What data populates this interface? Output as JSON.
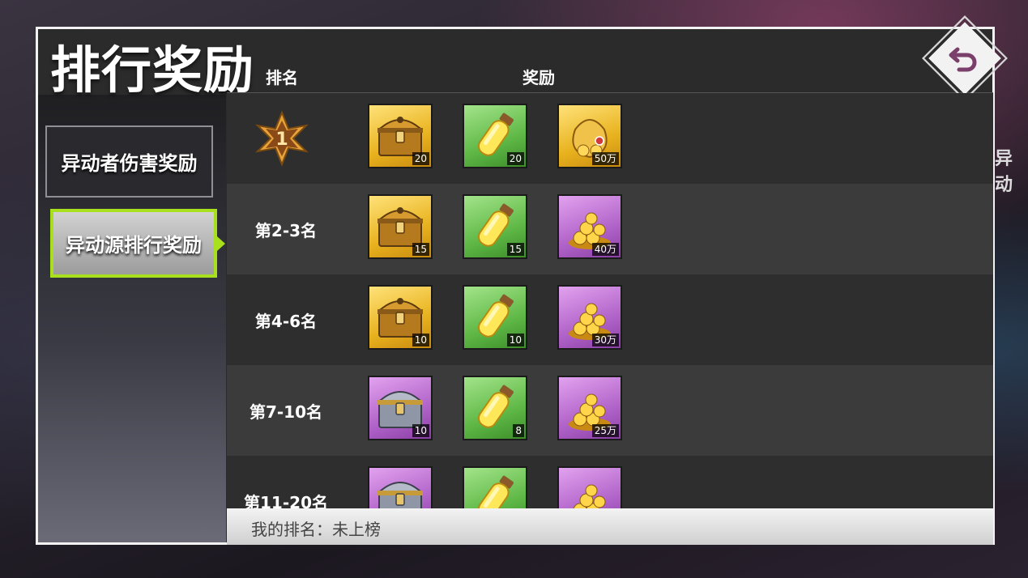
{
  "title": "排行奖励",
  "tabs": [
    {
      "label": "异动者伤害奖励",
      "selected": false
    },
    {
      "label": "异动源排行奖励",
      "selected": true
    }
  ],
  "table": {
    "col_rank": "排名",
    "col_reward": "奖励",
    "rows": [
      {
        "rank": "1",
        "rank_badge": true,
        "items": [
          {
            "type": "gold-chest",
            "qty": "20",
            "color": "gold"
          },
          {
            "type": "yellow-potion",
            "qty": "20",
            "color": "green"
          },
          {
            "type": "gold-bag",
            "qty": "50万",
            "color": "gold"
          }
        ]
      },
      {
        "rank": "第2-3名",
        "items": [
          {
            "type": "gold-chest",
            "qty": "15",
            "color": "gold"
          },
          {
            "type": "yellow-potion",
            "qty": "15",
            "color": "green"
          },
          {
            "type": "gold-coins",
            "qty": "40万",
            "color": "purple"
          }
        ]
      },
      {
        "rank": "第4-6名",
        "items": [
          {
            "type": "gold-chest",
            "qty": "10",
            "color": "gold"
          },
          {
            "type": "yellow-potion",
            "qty": "10",
            "color": "green"
          },
          {
            "type": "gold-coins",
            "qty": "30万",
            "color": "purple"
          }
        ]
      },
      {
        "rank": "第7-10名",
        "items": [
          {
            "type": "silver-chest",
            "qty": "10",
            "color": "purple"
          },
          {
            "type": "yellow-potion",
            "qty": "8",
            "color": "green"
          },
          {
            "type": "gold-coins",
            "qty": "25万",
            "color": "purple"
          }
        ]
      },
      {
        "rank": "第11-20名",
        "items": [
          {
            "type": "silver-chest",
            "qty": "",
            "color": "purple"
          },
          {
            "type": "yellow-potion",
            "qty": "",
            "color": "green"
          },
          {
            "type": "gold-coins",
            "qty": "",
            "color": "purple"
          }
        ]
      }
    ]
  },
  "footer": {
    "my_rank": "我的排名：未上榜"
  },
  "colors": {
    "accent": "#a8e01e",
    "panel_border": "#f2f2f2",
    "back_arrow": "#7a3f6a"
  }
}
